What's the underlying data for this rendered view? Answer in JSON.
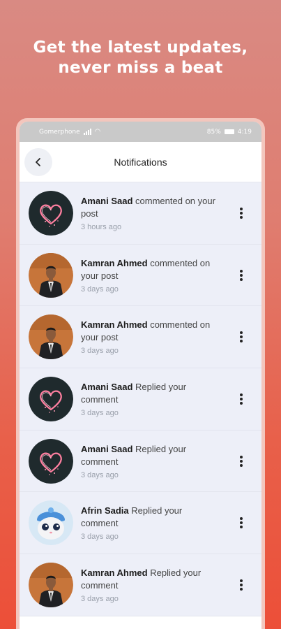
{
  "headline": {
    "line1": "Get the latest updates,",
    "line2": "never miss a beat"
  },
  "status_bar": {
    "carrier": "Gomerphone",
    "battery": "85%",
    "time": "4:19"
  },
  "header": {
    "title": "Notifications",
    "back_icon": "chevron-left-icon"
  },
  "notifications": [
    {
      "name": "Amani Saad",
      "action": "commented on your post",
      "time": "3 hours ago",
      "avatar": "heart"
    },
    {
      "name": "Kamran Ahmed",
      "action": "commented on your post",
      "time": "3 days ago",
      "avatar": "man"
    },
    {
      "name": "Kamran Ahmed",
      "action": "commented on your post",
      "time": "3 days ago",
      "avatar": "man"
    },
    {
      "name": "Amani Saad",
      "action": "Replied your comment",
      "time": "3 days ago",
      "avatar": "heart"
    },
    {
      "name": "Amani Saad",
      "action": "Replied your comment",
      "time": "3 days ago",
      "avatar": "heart"
    },
    {
      "name": "Afrin Sadia",
      "action": "Replied your comment",
      "time": "3 days ago",
      "avatar": "cat"
    },
    {
      "name": "Kamran Ahmed",
      "action": "Replied your comment",
      "time": "3 days ago",
      "avatar": "man"
    }
  ],
  "colors": {
    "accent": "#e8604a",
    "list_background": "#edeff8"
  }
}
